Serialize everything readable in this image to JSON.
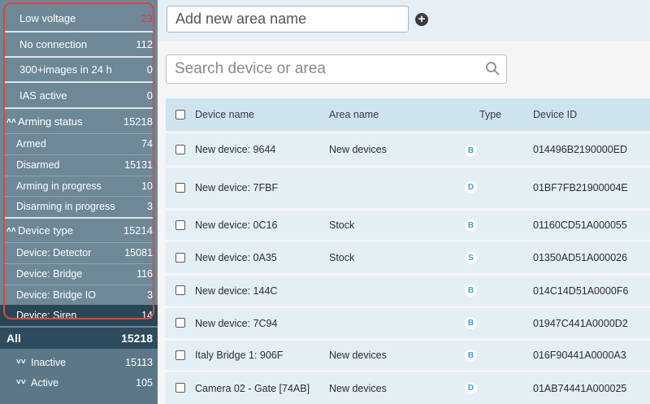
{
  "sidebar": {
    "top_items": [
      {
        "label": "Low voltage",
        "value": "23",
        "value_color": "#e53935"
      },
      {
        "label": "No connection",
        "value": "112"
      },
      {
        "label": "300+images in 24 h",
        "value": "0"
      },
      {
        "label": "IAS active",
        "value": "0"
      }
    ],
    "arming": {
      "title": "Arming status",
      "total": "15218",
      "items": [
        {
          "label": "Armed",
          "value": "74"
        },
        {
          "label": "Disarmed",
          "value": "15131"
        },
        {
          "label": "Arming in progress",
          "value": "10"
        },
        {
          "label": "Disarming in progress",
          "value": "3"
        }
      ]
    },
    "device_type": {
      "title": "Device type",
      "total": "15214",
      "items": [
        {
          "label": "Device: Detector",
          "value": "15081"
        },
        {
          "label": "Device: Bridge",
          "value": "116"
        },
        {
          "label": "Device: Bridge IO",
          "value": "3"
        },
        {
          "label": "Device: Siren",
          "value": "14",
          "selected": true
        }
      ]
    },
    "all": {
      "label": "All",
      "value": "15218"
    },
    "lower_items": [
      {
        "label": "Inactive",
        "value": "15113"
      },
      {
        "label": "Active",
        "value": "105"
      }
    ]
  },
  "area_input": {
    "placeholder": "Add new area name",
    "value": ""
  },
  "search": {
    "placeholder": "Search device or area",
    "value": ""
  },
  "table": {
    "columns": [
      "Device name",
      "Area name",
      "Type",
      "Device ID"
    ],
    "rows": [
      {
        "name": "New device: 9644",
        "area": "New devices",
        "type": "B",
        "id": "014496B2190000ED"
      },
      {
        "name": "New device: 7FBF",
        "area": "",
        "type": "D",
        "id": "01BF7FB21900004E"
      },
      {
        "name": "New device: 0C16",
        "area": "Stock",
        "type": "B",
        "id": "01160CD51A000055"
      },
      {
        "name": "New device: 0A35",
        "area": "Stock",
        "type": "S",
        "id": "01350AD51A000026"
      },
      {
        "name": "New device: 144C",
        "area": "",
        "type": "B",
        "id": "014C14D51A0000F6"
      },
      {
        "name": "New device: 7C94",
        "area": "",
        "type": "B",
        "id": "01947C441A0000D2"
      },
      {
        "name": "Italy Bridge 1: 906F",
        "area": "New devices",
        "type": "B",
        "id": "016F90441A0000A3"
      },
      {
        "name": "Camera 02 - Gate [74AB]",
        "area": "New devices",
        "type": "D",
        "id": "01AB74441A000025"
      }
    ]
  },
  "colors": {
    "sidebar": "#6e8897",
    "selected": "#2a4556",
    "highlight_frame": "#d9493f",
    "badge_text": "#3aa0d8"
  },
  "icons": {
    "add": "plus-circle-icon",
    "search": "magnifier-icon",
    "expand": "chevron-double-up-icon",
    "collapse": "chevron-double-down-icon"
  }
}
